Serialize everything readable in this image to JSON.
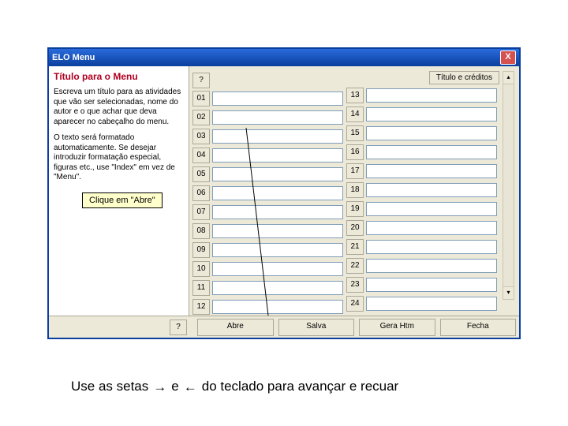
{
  "window": {
    "title": "ELO Menu",
    "close": "X"
  },
  "left": {
    "heading": "Título para o Menu",
    "p1": "Escreva um título para as atividades que vão ser selecionadas, nome do autor e o que achar que deva aparecer no cabeçalho do menu.",
    "p2": "O texto será formatado automaticamente. Se desejar introduzir formatação especial, figuras etc., use \"Index\" em vez de \"Menu\"."
  },
  "top_right": {
    "title_credits": "Título e créditos",
    "scroll_up": "▴",
    "scroll_down": "▾"
  },
  "rows_left": [
    "01",
    "02",
    "03",
    "04",
    "05",
    "06",
    "07",
    "08",
    "09",
    "10",
    "11",
    "12"
  ],
  "rows_right": [
    "13",
    "14",
    "15",
    "16",
    "17",
    "18",
    "19",
    "20",
    "21",
    "22",
    "23",
    "24"
  ],
  "bottom": {
    "q": "?",
    "abre": "Abre",
    "salva": "Salva",
    "gera": "Gera Htm",
    "fecha": "Fecha"
  },
  "tooltip": "Clique em \"Abre\"",
  "caption": {
    "t1": "Use as setas",
    "t2": "e",
    "t3": "do teclado para avançar e recuar",
    "arrow_right": "→",
    "arrow_left": "←"
  }
}
